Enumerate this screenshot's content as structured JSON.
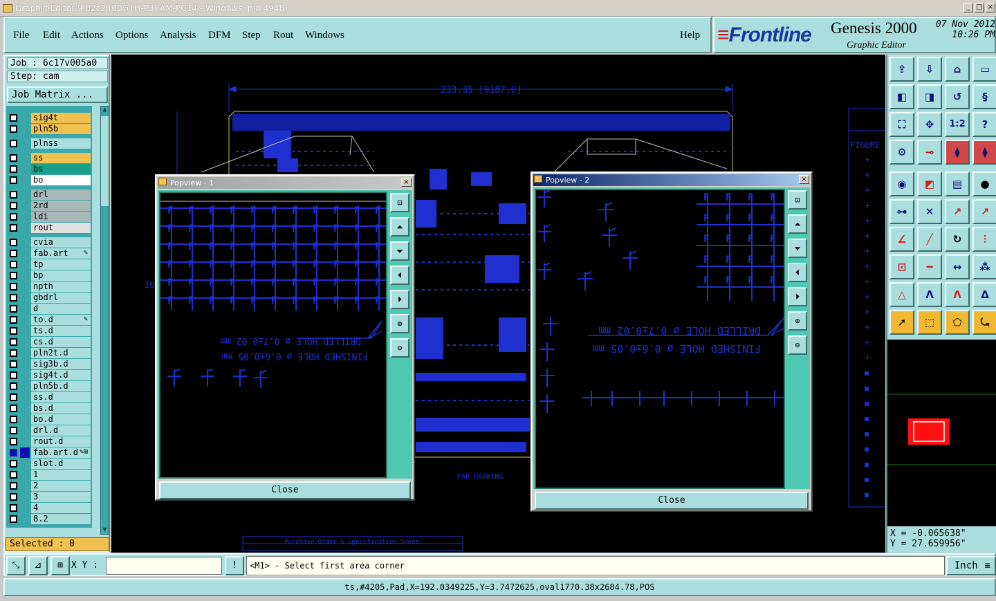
{
  "window": {
    "title": "Graphic Editor 9.02c2 (00@HY-P3CAM-PC14 - Windows, pid:4948)"
  },
  "menu": {
    "items": [
      "File",
      "Edit",
      "Actions",
      "Options",
      "Analysis",
      "DFM",
      "Step",
      "Rout",
      "Windows"
    ],
    "help": "Help"
  },
  "brand": {
    "logo": "Frontline",
    "product": "Genesis 2000",
    "subtitle": "Graphic Editor",
    "date": "07 Nov 2012",
    "time": "10:26 PM"
  },
  "job": {
    "job_line": "Job : 6c17v005a0",
    "step_line": "Step: cam",
    "matrix_button": "Job Matrix ..."
  },
  "layers": [
    {
      "name": "sig4t",
      "color": "#f0c050"
    },
    {
      "name": "pln5b",
      "color": "#f0c050"
    },
    {
      "name": "plnss",
      "color": "#aadede"
    },
    {
      "name": "ss",
      "color": "#f0c050"
    },
    {
      "name": "bs",
      "color": "#1aa088"
    },
    {
      "name": "bo",
      "color": "#ffffff"
    },
    {
      "name": "drl",
      "color": "#a8b8b8"
    },
    {
      "name": "2rd",
      "color": "#a8b8b8"
    },
    {
      "name": "ldi",
      "color": "#a8b8b8"
    },
    {
      "name": "rout",
      "color": "#e0e0e0"
    },
    {
      "name": "cvia",
      "color": "#aadede"
    },
    {
      "name": "fab.art",
      "color": "#aadede",
      "mark": "✎"
    },
    {
      "name": "tp",
      "color": "#aadede"
    },
    {
      "name": "bp",
      "color": "#aadede"
    },
    {
      "name": "npth",
      "color": "#aadede"
    },
    {
      "name": "gbdrl",
      "color": "#aadede"
    },
    {
      "name": "d",
      "color": "#aadede"
    },
    {
      "name": "to.d",
      "color": "#aadede",
      "mark": "✎"
    },
    {
      "name": "ts.d",
      "color": "#aadede"
    },
    {
      "name": "cs.d",
      "color": "#aadede"
    },
    {
      "name": "pln2t.d",
      "color": "#aadede"
    },
    {
      "name": "sig3b.d",
      "color": "#aadede"
    },
    {
      "name": "sig4t.d",
      "color": "#aadede"
    },
    {
      "name": "pln5b.d",
      "color": "#aadede"
    },
    {
      "name": "ss.d",
      "color": "#aadede"
    },
    {
      "name": "bs.d",
      "color": "#aadede"
    },
    {
      "name": "bo.d",
      "color": "#aadede"
    },
    {
      "name": "drl.d",
      "color": "#aadede"
    },
    {
      "name": "rout.d",
      "color": "#aadede"
    },
    {
      "name": "fab.art.d",
      "color": "#aadede",
      "mark": "✎⊞",
      "selected": true
    },
    {
      "name": "slot.d",
      "color": "#aadede"
    },
    {
      "name": "1",
      "color": "#aadede"
    },
    {
      "name": "2",
      "color": "#aadede"
    },
    {
      "name": "3",
      "color": "#aadede"
    },
    {
      "name": "4",
      "color": "#aadede"
    },
    {
      "name": "8.2",
      "color": "#aadede"
    }
  ],
  "selected_label": "Selected : 0",
  "canvas": {
    "dimension_text": "233.35 [9187.0]",
    "side_dim": "16",
    "fab_drawing": "FAB DRAWING",
    "figure_label": "FIGURE",
    "po_label": "Purchase Order & Specification Sheet"
  },
  "popview1": {
    "title": "Popview - 1",
    "close": "Close",
    "drilled": "DRILLED HOLE  ø 0.7±0.02 mm",
    "finished": "FINISHED HOLE  ø 0.6±0.05 mm"
  },
  "popview2": {
    "title": "Popview - 2",
    "close": "Close",
    "drilled": "DRILLED HOLE  ø 0.7±0.02 mm",
    "finished": "FINISHED HOLE  ø 0.6±0.05 mm"
  },
  "coords": {
    "x": "X = -0.065638\"",
    "y": "Y = 27.659956\""
  },
  "command": {
    "xy_label": "X Y :",
    "xy_value": "",
    "prompt": "<M1> - Select first area corner",
    "units": "Inch"
  },
  "status": "ts,#4205,Pad,X=192.0349225,Y=3.7472625,oval1770.38x2684.78,POS",
  "colors": {
    "panel": "#aadede",
    "canvas": "#000000",
    "feature": "#2030d0",
    "accent": "#f0c050"
  }
}
